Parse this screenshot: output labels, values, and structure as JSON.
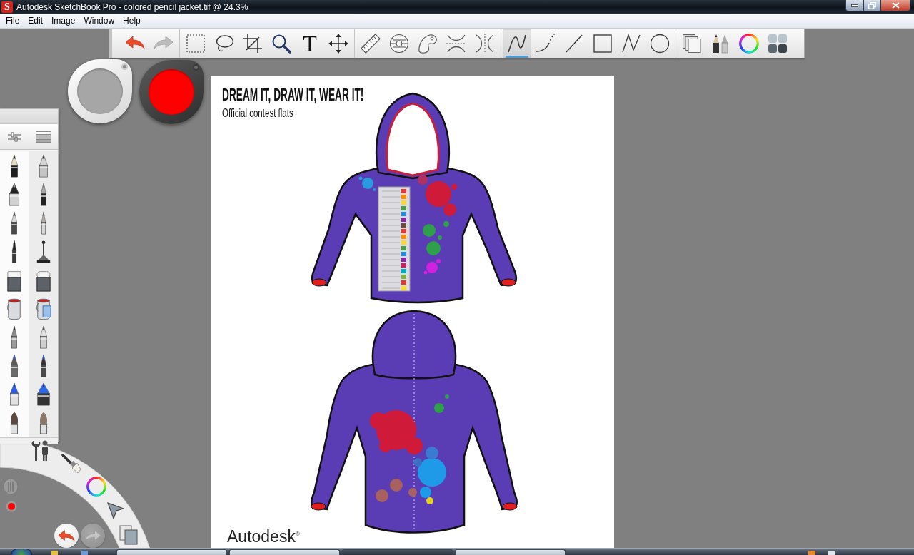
{
  "window": {
    "app_letter": "S",
    "title": "Autodesk SketchBook Pro - colored pencil jacket.tif @ 24.3%"
  },
  "menu": [
    "File",
    "Edit",
    "Image",
    "Window",
    "Help"
  ],
  "toolbar": {
    "groups": [
      {
        "tools": [
          {
            "kind": "undo"
          },
          {
            "kind": "redo"
          }
        ]
      },
      {
        "tools": [
          {
            "kind": "select-rect",
            "selected": false
          },
          {
            "kind": "lasso",
            "selected": false
          },
          {
            "kind": "crop",
            "selected": false
          },
          {
            "kind": "zoom",
            "selected": false
          },
          {
            "kind": "text",
            "label": "T",
            "selected": false
          },
          {
            "kind": "move",
            "selected": false
          }
        ]
      },
      {
        "tools": [
          {
            "kind": "ruler",
            "selected": false
          },
          {
            "kind": "ellipse-guide",
            "selected": false
          },
          {
            "kind": "french-curve",
            "selected": false
          },
          {
            "kind": "symmetry-x",
            "selected": false
          },
          {
            "kind": "symmetry-y",
            "selected": false
          }
        ]
      },
      {
        "tools": [
          {
            "kind": "freehand",
            "selected": true
          },
          {
            "kind": "curve",
            "selected": false
          },
          {
            "kind": "line",
            "selected": false
          },
          {
            "kind": "rectangle",
            "selected": false
          },
          {
            "kind": "polyline",
            "selected": false
          },
          {
            "kind": "ellipse",
            "selected": false
          }
        ]
      },
      {
        "tools": [
          {
            "kind": "layers"
          },
          {
            "kind": "brushes"
          },
          {
            "kind": "color-wheel"
          },
          {
            "kind": "swatches"
          }
        ]
      }
    ]
  },
  "pucks": [
    {
      "kind": "light",
      "color": "#a6a6a6"
    },
    {
      "kind": "dark",
      "color": "#ff0000"
    }
  ],
  "palette": {
    "brushes": [
      {
        "kind": "pencil"
      },
      {
        "kind": "technical"
      },
      {
        "kind": "marker"
      },
      {
        "kind": "chisel"
      },
      {
        "kind": "ballpoint"
      },
      {
        "kind": "nib"
      },
      {
        "kind": "felt"
      },
      {
        "kind": "airbrush"
      },
      {
        "kind": "eraser"
      },
      {
        "kind": "round-eraser"
      },
      {
        "kind": "bucket"
      },
      {
        "kind": "fill"
      },
      {
        "kind": "gray-pen"
      },
      {
        "kind": "silver-pen"
      },
      {
        "kind": "blue-pen"
      },
      {
        "kind": "blue-felt"
      },
      {
        "kind": "blue-marker"
      },
      {
        "kind": "wide-marker"
      },
      {
        "kind": "brush"
      },
      {
        "kind": "bristle"
      }
    ]
  },
  "lagoon": {
    "items": [
      {
        "kind": "tools"
      },
      {
        "kind": "brush"
      },
      {
        "kind": "color-wheel"
      },
      {
        "kind": "cursor"
      },
      {
        "kind": "layers"
      },
      {
        "kind": "size"
      },
      {
        "kind": "color",
        "color": "#ff0000"
      },
      {
        "kind": "undo"
      },
      {
        "kind": "redo"
      }
    ]
  },
  "document": {
    "headline": "DREAM IT, DRAW IT, WEAR IT!",
    "subtitle": "Official contest flats",
    "logo": "Autodesk$^{®}$"
  },
  "taskbar": {
    "buttons": [
      {
        "selected": false
      },
      {
        "selected": false
      },
      {
        "selected": true
      },
      {
        "selected": false
      }
    ]
  }
}
